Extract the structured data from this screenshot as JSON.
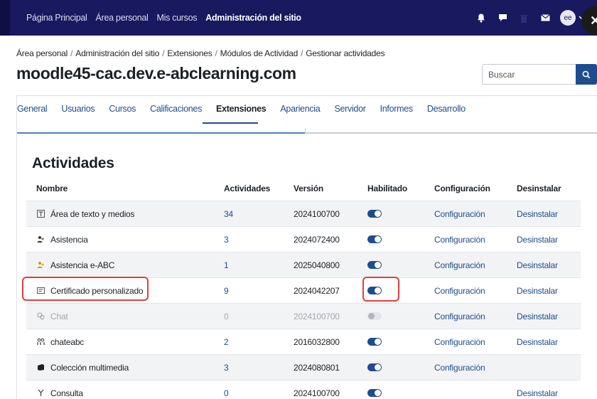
{
  "navbar": {
    "items": [
      "Página Principal",
      "Área personal",
      "Mis cursos",
      "Administración del sitio"
    ],
    "active_index": 3,
    "avatar_initials": "ee",
    "close_glyph": "✕",
    "icons": [
      "bell-icon",
      "chat-icon",
      "trash-icon",
      "mail-icon"
    ]
  },
  "breadcrumb": [
    "Área personal",
    "Administración del sitio",
    "Extensiones",
    "Módulos de Actividad",
    "Gestionar actividades"
  ],
  "breadcrumb_separator": "/",
  "site_title": "moodle45-cac.dev.e-abclearning.com",
  "search": {
    "placeholder": "Buscar"
  },
  "tabs": [
    "General",
    "Usuarios",
    "Cursos",
    "Calificaciones",
    "Extensiones",
    "Apariencia",
    "Servidor",
    "Informes",
    "Desarrollo"
  ],
  "active_tab": "Extensiones",
  "section_title": "Actividades",
  "table": {
    "headers": [
      "Nombre",
      "Actividades",
      "Versión",
      "Habilitado",
      "Configuración",
      "Desinstalar"
    ],
    "rows": [
      {
        "name": "Área de texto y medios",
        "icon": "text-media-icon",
        "count": "34",
        "version": "2024100700",
        "enabled": true,
        "config": "Configuración",
        "uninstall": "Desinstalar"
      },
      {
        "name": "Asistencia",
        "icon": "attendance-icon",
        "count": "3",
        "version": "2024072400",
        "enabled": true,
        "config": "Configuración",
        "uninstall": "Desinstalar"
      },
      {
        "name": "Asistencia e-ABC",
        "icon": "attendance-eabc-icon",
        "count": "1",
        "version": "2025040800",
        "enabled": true,
        "config": "Configuración",
        "uninstall": "Desinstalar"
      },
      {
        "name": "Certificado personalizado",
        "icon": "certificate-icon",
        "count": "9",
        "version": "2024042207",
        "enabled": true,
        "config": "Configuración",
        "uninstall": "Desinstalar"
      },
      {
        "name": "Chat",
        "icon": "chat-module-icon",
        "count": "0",
        "version": "2024100700",
        "enabled": false,
        "config": "Configuración",
        "uninstall": "Desinstalar"
      },
      {
        "name": "chateabc",
        "icon": "chateabc-icon",
        "count": "2",
        "version": "2016032800",
        "enabled": true,
        "config": "Configuración",
        "uninstall": "Desinstalar"
      },
      {
        "name": "Colección multimedia",
        "icon": "multimedia-collection-icon",
        "count": "3",
        "version": "2024080801",
        "enabled": true,
        "config": "Configuración",
        "uninstall": ""
      },
      {
        "name": "Consulta",
        "icon": "choice-icon",
        "count": "0",
        "version": "2024100700",
        "enabled": true,
        "config": "",
        "uninstall": "Desinstalar"
      }
    ]
  },
  "highlights": [
    "certificate-name",
    "certificate-toggle"
  ],
  "colors": {
    "navbar": "#18195e",
    "link": "#1e4d8f",
    "highlight": "#e43d3d"
  }
}
